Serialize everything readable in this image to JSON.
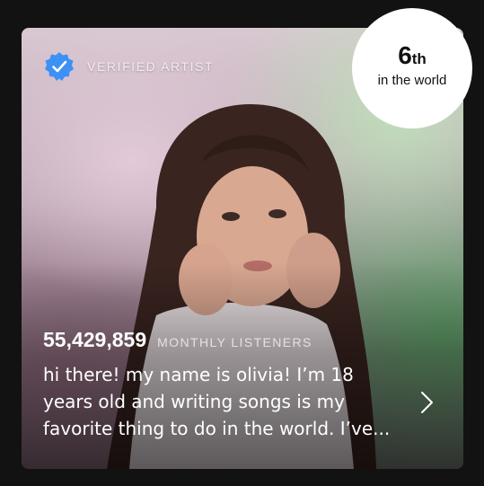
{
  "verified_badge": {
    "label": "VERIFIED ARTIST",
    "icon": "verified-check-icon",
    "color": "#3d91f4"
  },
  "rank": {
    "number": "6",
    "suffix": "th",
    "caption": "in the world"
  },
  "listeners": {
    "count": "55,429,859",
    "label": "MONTHLY LISTENERS"
  },
  "bio": {
    "lines": [
      "hi there! my name is olivia! I’m 18",
      "years old and writing songs is my",
      "favorite thing to do in the world. I’ve..."
    ]
  },
  "more_icon": "chevron-right-icon"
}
